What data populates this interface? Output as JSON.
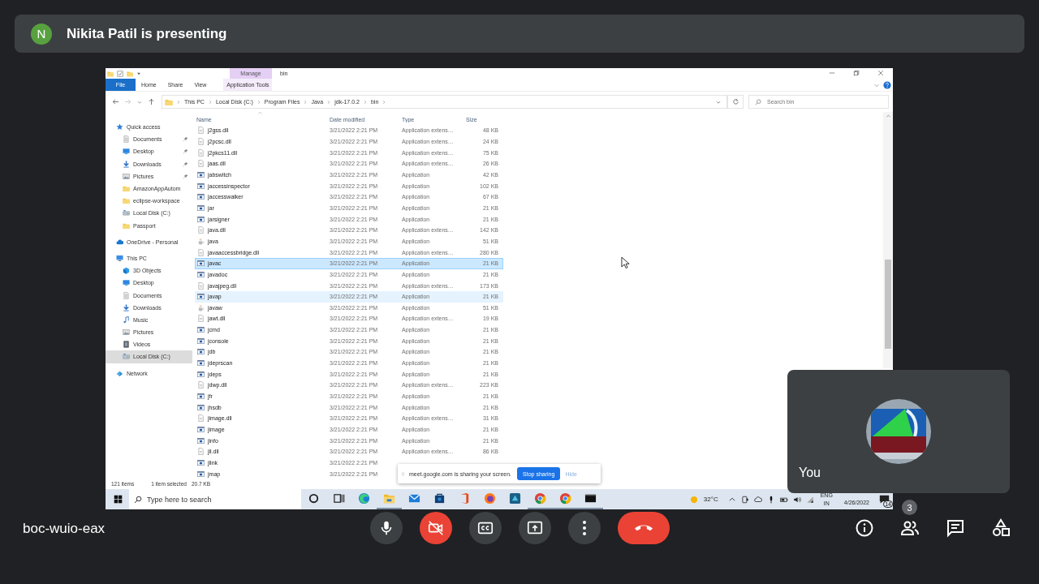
{
  "banner": {
    "initial": "N",
    "text": "Nikita Patil is presenting"
  },
  "explorer": {
    "context_label": "Manage",
    "title": "bin",
    "ribbon_tabs": [
      {
        "label": "File",
        "kind": "file"
      },
      {
        "label": "Home",
        "kind": "tab"
      },
      {
        "label": "Share",
        "kind": "tab"
      },
      {
        "label": "View",
        "kind": "tab"
      },
      {
        "label": "Application Tools",
        "kind": "context"
      }
    ],
    "breadcrumbs": [
      "This PC",
      "Local Disk (C:)",
      "Program Files",
      "Java",
      "jdk-17.0.2",
      "bin"
    ],
    "search": {
      "placeholder": "Search bin"
    },
    "nav": [
      {
        "label": "Quick access",
        "kind": "star",
        "selected": false,
        "children": [
          {
            "label": "Documents",
            "kind": "docs",
            "pinned": true,
            "selected": false
          },
          {
            "label": "Desktop",
            "kind": "desktop",
            "pinned": true,
            "selected": false
          },
          {
            "label": "Downloads",
            "kind": "download",
            "pinned": true,
            "selected": false
          },
          {
            "label": "Pictures",
            "kind": "pictures",
            "pinned": true,
            "selected": false
          },
          {
            "label": "AmazonAppAutom",
            "kind": "folder",
            "pinned": false,
            "selected": false
          },
          {
            "label": "eclipse-workspace",
            "kind": "folder",
            "pinned": false,
            "selected": false
          },
          {
            "label": "Local Disk (C:)",
            "kind": "drive",
            "pinned": false,
            "selected": false
          },
          {
            "label": "Passport",
            "kind": "folder",
            "pinned": false,
            "selected": false
          }
        ]
      },
      {
        "label": "OneDrive - Personal",
        "kind": "cloud",
        "selected": false
      },
      {
        "label": "This PC",
        "kind": "pc",
        "selected": false,
        "children": [
          {
            "label": "3D Objects",
            "kind": "cube",
            "selected": false
          },
          {
            "label": "Desktop",
            "kind": "desktop",
            "selected": false
          },
          {
            "label": "Documents",
            "kind": "docs",
            "selected": false
          },
          {
            "label": "Downloads",
            "kind": "download",
            "selected": false
          },
          {
            "label": "Music",
            "kind": "music",
            "selected": false
          },
          {
            "label": "Pictures",
            "kind": "pictures",
            "selected": false
          },
          {
            "label": "Videos",
            "kind": "videos",
            "selected": false
          },
          {
            "label": "Local Disk (C:)",
            "kind": "drive",
            "selected": true
          }
        ]
      },
      {
        "label": "Network",
        "kind": "network",
        "selected": false
      }
    ],
    "columns": [
      "Name",
      "Date modified",
      "Type",
      "Size"
    ],
    "files": [
      {
        "name": "j2gss.dll",
        "kind": "dll",
        "modified": "3/21/2022 2:21 PM",
        "type": "Application extens…",
        "size": "48 KB",
        "selected": false,
        "hovered": false
      },
      {
        "name": "j2pcsc.dll",
        "kind": "dll",
        "modified": "3/21/2022 2:21 PM",
        "type": "Application extens…",
        "size": "24 KB",
        "selected": false,
        "hovered": false
      },
      {
        "name": "j2pkcs11.dll",
        "kind": "dll",
        "modified": "3/21/2022 2:21 PM",
        "type": "Application extens…",
        "size": "75 KB",
        "selected": false,
        "hovered": false
      },
      {
        "name": "jaas.dll",
        "kind": "dll",
        "modified": "3/21/2022 2:21 PM",
        "type": "Application extens…",
        "size": "26 KB",
        "selected": false,
        "hovered": false
      },
      {
        "name": "jabswitch",
        "kind": "app",
        "modified": "3/21/2022 2:21 PM",
        "type": "Application",
        "size": "42 KB",
        "selected": false,
        "hovered": false
      },
      {
        "name": "jaccessinspector",
        "kind": "app",
        "modified": "3/21/2022 2:21 PM",
        "type": "Application",
        "size": "102 KB",
        "selected": false,
        "hovered": false
      },
      {
        "name": "jaccesswalker",
        "kind": "app",
        "modified": "3/21/2022 2:21 PM",
        "type": "Application",
        "size": "67 KB",
        "selected": false,
        "hovered": false
      },
      {
        "name": "jar",
        "kind": "app",
        "modified": "3/21/2022 2:21 PM",
        "type": "Application",
        "size": "21 KB",
        "selected": false,
        "hovered": false
      },
      {
        "name": "jarsigner",
        "kind": "app",
        "modified": "3/21/2022 2:21 PM",
        "type": "Application",
        "size": "21 KB",
        "selected": false,
        "hovered": false
      },
      {
        "name": "java.dll",
        "kind": "dll",
        "modified": "3/21/2022 2:21 PM",
        "type": "Application extens…",
        "size": "142 KB",
        "selected": false,
        "hovered": false
      },
      {
        "name": "java",
        "kind": "java",
        "modified": "3/21/2022 2:21 PM",
        "type": "Application",
        "size": "51 KB",
        "selected": false,
        "hovered": false
      },
      {
        "name": "javaaccessbridge.dll",
        "kind": "dll",
        "modified": "3/21/2022 2:21 PM",
        "type": "Application extens…",
        "size": "280 KB",
        "selected": false,
        "hovered": false
      },
      {
        "name": "javac",
        "kind": "app",
        "modified": "3/21/2022 2:21 PM",
        "type": "Application",
        "size": "21 KB",
        "selected": true,
        "hovered": false
      },
      {
        "name": "javadoc",
        "kind": "app",
        "modified": "3/21/2022 2:21 PM",
        "type": "Application",
        "size": "21 KB",
        "selected": false,
        "hovered": false
      },
      {
        "name": "javajpeg.dll",
        "kind": "dll",
        "modified": "3/21/2022 2:21 PM",
        "type": "Application extens…",
        "size": "173 KB",
        "selected": false,
        "hovered": false
      },
      {
        "name": "javap",
        "kind": "app",
        "modified": "3/21/2022 2:21 PM",
        "type": "Application",
        "size": "21 KB",
        "selected": false,
        "hovered": true
      },
      {
        "name": "javaw",
        "kind": "java",
        "modified": "3/21/2022 2:21 PM",
        "type": "Application",
        "size": "51 KB",
        "selected": false,
        "hovered": false
      },
      {
        "name": "jawt.dll",
        "kind": "dll",
        "modified": "3/21/2022 2:21 PM",
        "type": "Application extens…",
        "size": "19 KB",
        "selected": false,
        "hovered": false
      },
      {
        "name": "jcmd",
        "kind": "app",
        "modified": "3/21/2022 2:21 PM",
        "type": "Application",
        "size": "21 KB",
        "selected": false,
        "hovered": false
      },
      {
        "name": "jconsole",
        "kind": "app",
        "modified": "3/21/2022 2:21 PM",
        "type": "Application",
        "size": "21 KB",
        "selected": false,
        "hovered": false
      },
      {
        "name": "jdb",
        "kind": "app",
        "modified": "3/21/2022 2:21 PM",
        "type": "Application",
        "size": "21 KB",
        "selected": false,
        "hovered": false
      },
      {
        "name": "jdeprscan",
        "kind": "app",
        "modified": "3/21/2022 2:21 PM",
        "type": "Application",
        "size": "21 KB",
        "selected": false,
        "hovered": false
      },
      {
        "name": "jdeps",
        "kind": "app",
        "modified": "3/21/2022 2:21 PM",
        "type": "Application",
        "size": "21 KB",
        "selected": false,
        "hovered": false
      },
      {
        "name": "jdwp.dll",
        "kind": "dll",
        "modified": "3/21/2022 2:21 PM",
        "type": "Application extens…",
        "size": "223 KB",
        "selected": false,
        "hovered": false
      },
      {
        "name": "jfr",
        "kind": "app",
        "modified": "3/21/2022 2:21 PM",
        "type": "Application",
        "size": "21 KB",
        "selected": false,
        "hovered": false
      },
      {
        "name": "jhsdb",
        "kind": "app",
        "modified": "3/21/2022 2:21 PM",
        "type": "Application",
        "size": "21 KB",
        "selected": false,
        "hovered": false
      },
      {
        "name": "jimage.dll",
        "kind": "dll",
        "modified": "3/21/2022 2:21 PM",
        "type": "Application extens…",
        "size": "31 KB",
        "selected": false,
        "hovered": false
      },
      {
        "name": "jimage",
        "kind": "app",
        "modified": "3/21/2022 2:21 PM",
        "type": "Application",
        "size": "21 KB",
        "selected": false,
        "hovered": false
      },
      {
        "name": "jinfo",
        "kind": "app",
        "modified": "3/21/2022 2:21 PM",
        "type": "Application",
        "size": "21 KB",
        "selected": false,
        "hovered": false
      },
      {
        "name": "jli.dll",
        "kind": "dll",
        "modified": "3/21/2022 2:21 PM",
        "type": "Application extens…",
        "size": "86 KB",
        "selected": false,
        "hovered": false
      },
      {
        "name": "jlink",
        "kind": "app",
        "modified": "3/21/2022 2:21 PM",
        "selected": false,
        "hovered": false
      },
      {
        "name": "jmap",
        "kind": "app",
        "modified": "3/21/2022 2:21 PM",
        "selected": false,
        "hovered": false
      }
    ],
    "status": {
      "count": "121 items",
      "selection": "1 item selected",
      "size": "20.7 KB"
    }
  },
  "taskbar": {
    "search_placeholder": "Type here to search",
    "apps": [
      {
        "kind": "cortana",
        "active": false
      },
      {
        "kind": "taskview",
        "active": false
      },
      {
        "kind": "edge",
        "active": false
      },
      {
        "kind": "explorer",
        "active": true
      },
      {
        "kind": "mail",
        "active": false
      },
      {
        "kind": "store",
        "active": false
      },
      {
        "kind": "office",
        "active": false
      },
      {
        "kind": "firefox",
        "active": false
      },
      {
        "kind": "app",
        "active": false
      },
      {
        "kind": "chrome",
        "active": true
      },
      {
        "kind": "chrome",
        "active": true
      },
      {
        "kind": "terminal",
        "active": true
      }
    ],
    "weather": "32°C",
    "language": "ENG",
    "region": "IN",
    "date": "4/26/2022",
    "notifications": "14"
  },
  "share_notice": {
    "text": "meet.google.com is sharing your screen.",
    "stop": "Stop sharing",
    "hide": "Hide"
  },
  "self_tile": {
    "label": "You"
  },
  "meeting_code": "boc-wuio-eax",
  "controls": [
    {
      "kind": "mic",
      "on": true
    },
    {
      "kind": "camera",
      "on": false
    },
    {
      "kind": "captions",
      "on": false
    },
    {
      "kind": "present",
      "on": false
    },
    {
      "kind": "more",
      "on": false
    }
  ],
  "side_buttons": [
    {
      "kind": "info"
    },
    {
      "kind": "people",
      "badge": "3"
    },
    {
      "kind": "chat"
    },
    {
      "kind": "activities"
    }
  ]
}
